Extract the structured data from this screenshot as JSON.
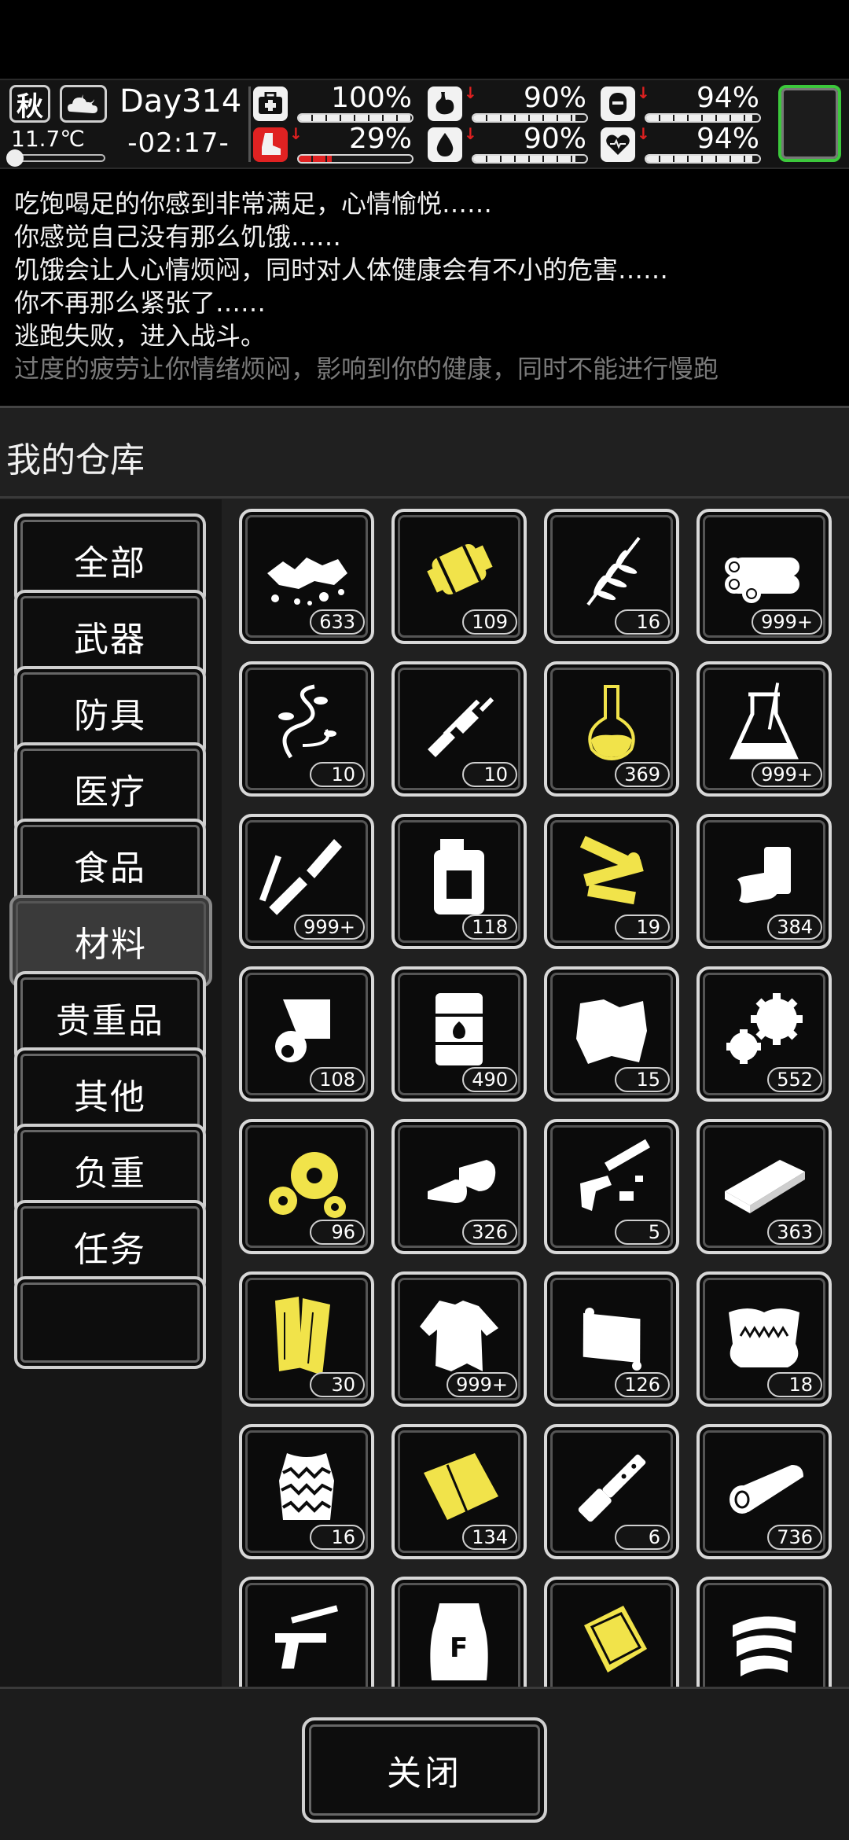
{
  "status": {
    "season": "秋",
    "weather_icon": "cloudy-moon-icon",
    "temperature": "11.7℃",
    "day": "Day314",
    "time": "-02:17-",
    "stats": [
      {
        "name": "health",
        "icon": "medkit-icon",
        "value": "100%",
        "fraction": 1.0,
        "down": false
      },
      {
        "name": "hunger",
        "icon": "stomach-icon",
        "value": "90%",
        "fraction": 0.9,
        "down": true
      },
      {
        "name": "mood",
        "icon": "mood-icon",
        "value": "94%",
        "fraction": 0.94,
        "down": true
      },
      {
        "name": "stamina",
        "icon": "boot-icon",
        "value": "29%",
        "fraction": 0.29,
        "down": true,
        "color": "#e02222"
      },
      {
        "name": "thirst",
        "icon": "water-drop-icon",
        "value": "90%",
        "fraction": 0.9,
        "down": true
      },
      {
        "name": "heart",
        "icon": "heart-icon",
        "value": "94%",
        "fraction": 0.94,
        "down": true
      }
    ],
    "slot_border_color": "#3cc83c"
  },
  "log": [
    "吃饱喝足的你感到非常满足，心情愉悦……",
    "你感觉自己没有那么饥饿……",
    "饥饿会让人心情烦闷，同时对人体健康会有不小的危害……",
    "你不再那么紧张了……",
    "逃跑失败，进入战斗。",
    "过度的疲劳让你情绪烦闷，影响到你的健康，同时不能进行慢跑"
  ],
  "panel": {
    "title": "我的仓库",
    "categories": [
      "全部",
      "武器",
      "防具",
      "医疗",
      "食品",
      "材料",
      "贵重品",
      "其他",
      "负重",
      "任务"
    ],
    "active_category": "材料",
    "close_label": "关闭"
  },
  "items": [
    {
      "icon": "rubble-icon",
      "count": "633",
      "color": "#ffffff"
    },
    {
      "icon": "yellow-canister-icon",
      "count": "109",
      "color": "#f1e34a"
    },
    {
      "icon": "fern-icon",
      "count": "16",
      "color": "#ffffff"
    },
    {
      "icon": "logs-icon",
      "count": "999+",
      "color": "#ffffff"
    },
    {
      "icon": "vine-icon",
      "count": "10",
      "color": "#ffffff"
    },
    {
      "icon": "broken-rifle-icon",
      "count": "10",
      "color": "#ffffff"
    },
    {
      "icon": "yellow-flask-icon",
      "count": "369",
      "color": "#f1e34a"
    },
    {
      "icon": "beaker-icon",
      "count": "999+",
      "color": "#ffffff"
    },
    {
      "icon": "welding-torch-icon",
      "count": "999+",
      "color": "#ffffff"
    },
    {
      "icon": "jerrycan-icon",
      "count": "118",
      "color": "#ffffff"
    },
    {
      "icon": "yellow-parts-icon",
      "count": "19",
      "color": "#f1e34a"
    },
    {
      "icon": "cans-icon",
      "count": "384",
      "color": "#ffffff"
    },
    {
      "icon": "paper-roll-icon",
      "count": "108",
      "color": "#ffffff"
    },
    {
      "icon": "fuel-barrel-icon",
      "count": "490",
      "color": "#ffffff"
    },
    {
      "icon": "cloth-scrap-icon",
      "count": "15",
      "color": "#ffffff"
    },
    {
      "icon": "gears-icon",
      "count": "552",
      "color": "#ffffff"
    },
    {
      "icon": "yellow-gears-icon",
      "count": "96",
      "color": "#f1e34a"
    },
    {
      "icon": "bullets-icon",
      "count": "326",
      "color": "#ffffff"
    },
    {
      "icon": "gun-parts-icon",
      "count": "5",
      "color": "#ffffff"
    },
    {
      "icon": "metal-plate-icon",
      "count": "363",
      "color": "#ffffff"
    },
    {
      "icon": "yellow-planks-icon",
      "count": "30",
      "color": "#f1e34a"
    },
    {
      "icon": "torn-shirt-icon",
      "count": "999+",
      "color": "#ffffff"
    },
    {
      "icon": "leather-pad-icon",
      "count": "126",
      "color": "#ffffff"
    },
    {
      "icon": "fur-pelt-icon",
      "count": "18",
      "color": "#ffffff"
    },
    {
      "icon": "zebra-pelt-icon",
      "count": "16",
      "color": "#ffffff"
    },
    {
      "icon": "yellow-tarp-icon",
      "count": "134",
      "color": "#f1e34a"
    },
    {
      "icon": "pipe-icon",
      "count": "6",
      "color": "#ffffff"
    },
    {
      "icon": "wood-log-icon",
      "count": "736",
      "color": "#ffffff"
    },
    {
      "icon": "pistol-parts-icon",
      "count": "",
      "color": "#ffffff"
    },
    {
      "icon": "flour-sack-icon",
      "count": "",
      "color": "#ffffff"
    },
    {
      "icon": "yellow-sign-icon",
      "count": "",
      "color": "#f1e34a"
    },
    {
      "icon": "tape-rolls-icon",
      "count": "",
      "color": "#ffffff"
    }
  ]
}
